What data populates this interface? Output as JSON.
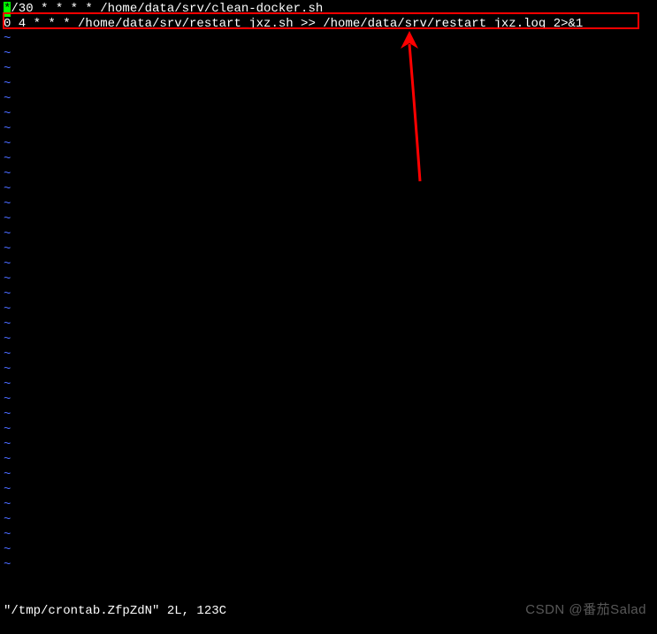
{
  "editor": {
    "line1_prefix": "*",
    "line1_rest": "/30 * * * * /home/data/srv/clean-docker.sh",
    "line2": "0 4 * * * /home/data/srv/restart_jxz.sh >> /home/data/srv/restart_jxz.log 2>&1",
    "tilde": "~",
    "status": "\"/tmp/crontab.ZfpZdN\" 2L, 123C"
  },
  "watermark": "CSDN @番茄Salad"
}
